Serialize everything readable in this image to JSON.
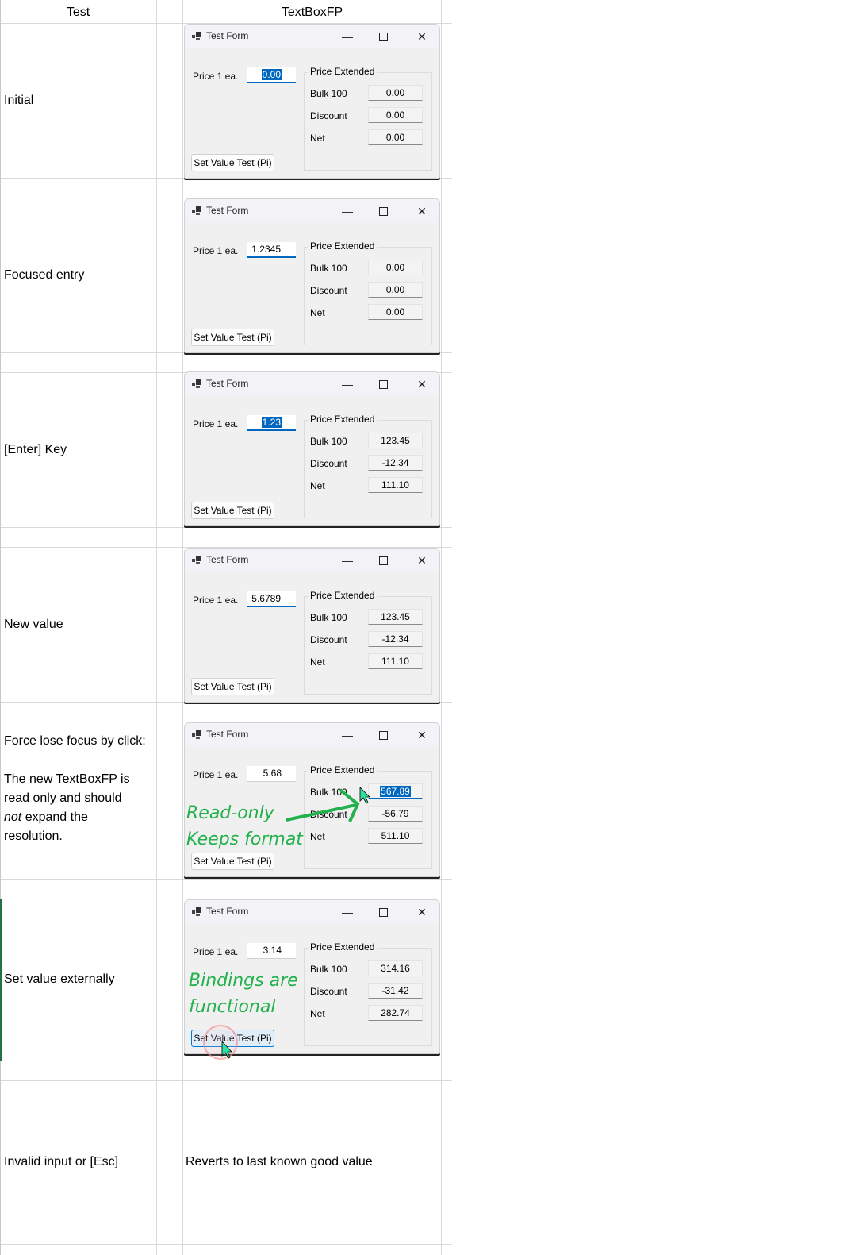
{
  "headers": {
    "test": "Test",
    "result": "TextBoxFP"
  },
  "window": {
    "title": "Test Form",
    "minimize": "—",
    "close": "✕",
    "price_label": "Price 1 ea.",
    "group_title": "Price Extended",
    "row_labels": {
      "bulk": "Bulk 100",
      "discount": "Discount",
      "net": "Net"
    },
    "button_label": "Set Value Test (Pi)"
  },
  "rows": [
    {
      "test": "Initial",
      "price": "0.00",
      "price_state": "selected",
      "bulk": "0.00",
      "discount": "0.00",
      "net": "0.00"
    },
    {
      "test": "Focused entry",
      "price": "1.2345",
      "price_state": "caret",
      "bulk": "0.00",
      "discount": "0.00",
      "net": "0.00"
    },
    {
      "test": "[Enter] Key",
      "price": "1.23",
      "price_state": "selected",
      "bulk": "123.45",
      "discount": "-12.34",
      "net": "111.10"
    },
    {
      "test": "New value",
      "price": "5.6789",
      "price_state": "caret",
      "bulk": "123.45",
      "discount": "-12.34",
      "net": "111.10"
    },
    {
      "test_lines": [
        "Force lose focus by click:",
        "",
        "The new TextBoxFP is",
        "read only and should"
      ],
      "test_not": "not",
      "test_rest": " expand the",
      "test_last": "resolution.",
      "price": "5.68",
      "price_state": "none",
      "bulk": "567.89",
      "discount": "-56.79",
      "net": "511.10",
      "annotation_1": "Read-only",
      "annotation_2": "Keeps format"
    },
    {
      "test": "Set value externally",
      "price": "3.14",
      "price_state": "none",
      "bulk": "314.16",
      "discount": "-31.42",
      "net": "282.74",
      "annotation_1": "Bindings are",
      "annotation_2": "functional"
    },
    {
      "test": "Invalid input or [Esc]",
      "result_text": "Reverts to last known good value"
    }
  ],
  "colors": {
    "accent": "#0067c0",
    "annotation": "#22b14c",
    "grid": "#d9d9d9"
  }
}
